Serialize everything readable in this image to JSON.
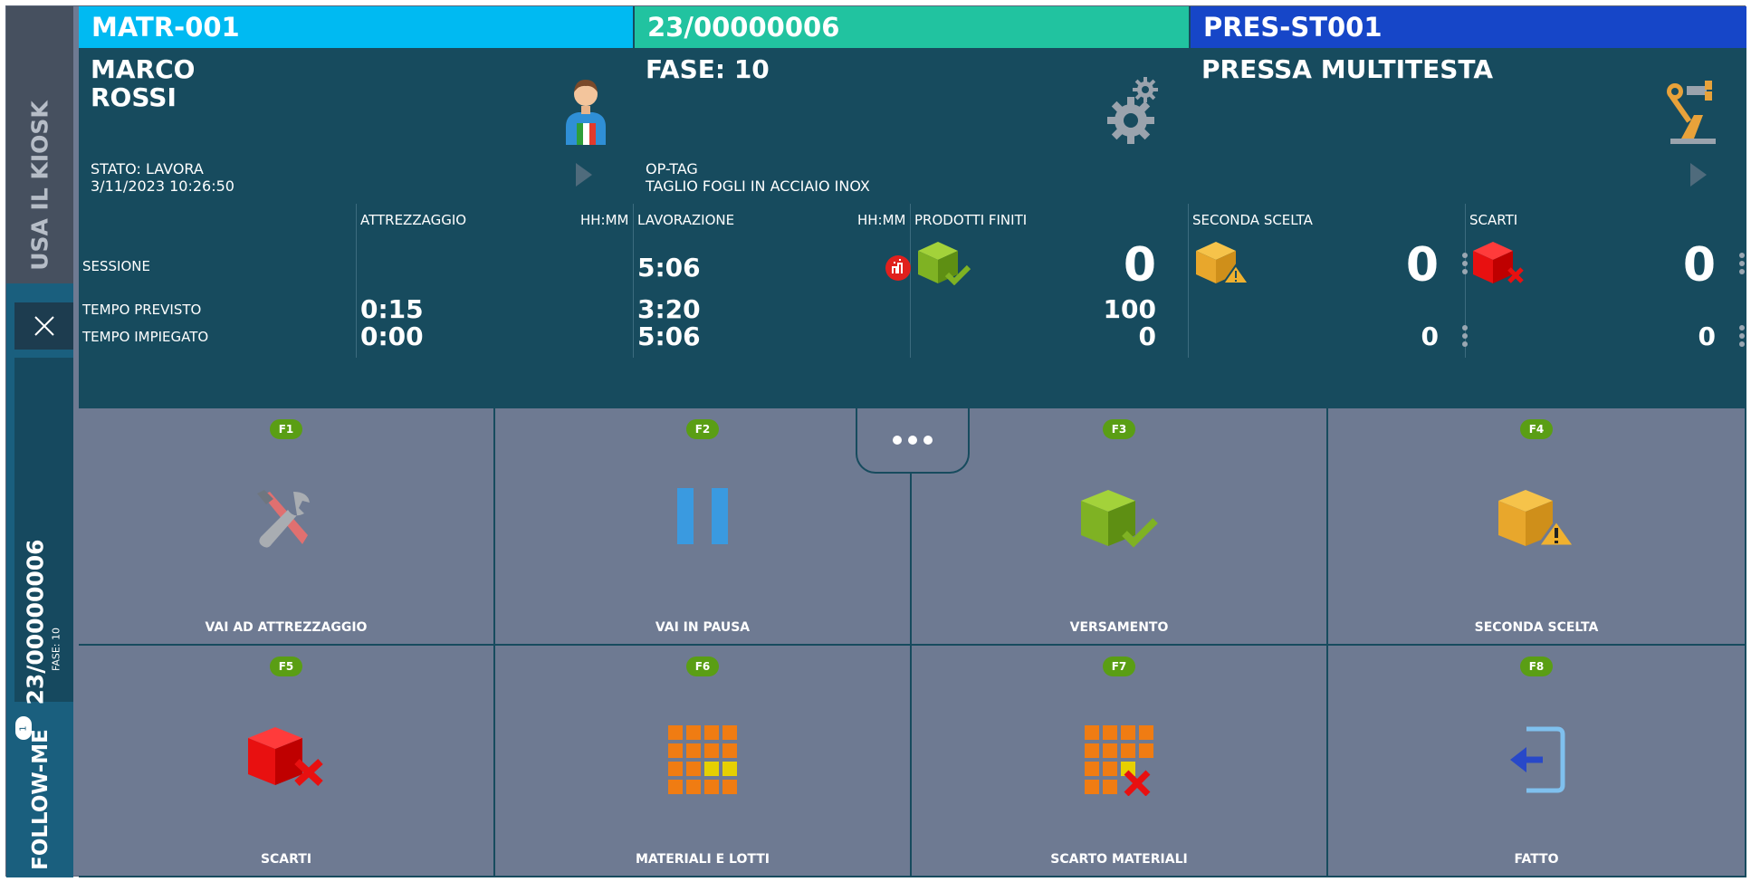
{
  "sidebar": {
    "kiosk_label": "USA IL KIOSK",
    "order_number": "23/00000006",
    "order_phase": "FASE: 10",
    "follow_badge": "1",
    "follow_label": "FOLLOW-ME"
  },
  "operator": {
    "code": "MATR-001",
    "first_name": "MARCO",
    "last_name": "ROSSI",
    "status": "STATO: LAVORA",
    "datetime": "3/11/2023 10:26:50"
  },
  "order": {
    "code": "23/00000006",
    "phase": "FASE: 10",
    "operation_tag": "OP-TAG",
    "operation_desc": "TAGLIO FOGLI IN ACCIAIO INOX"
  },
  "resource": {
    "code": "PRES-ST001",
    "name": "PRESSA MULTITESTA"
  },
  "stats": {
    "row_labels": {
      "session": "SESSIONE",
      "expected": "TEMPO PREVISTO",
      "elapsed": "TEMPO IMPIEGATO"
    },
    "setup": {
      "header": "ATTREZZAGGIO",
      "unit": "HH:MM",
      "expected": "0:15",
      "elapsed": "0:00"
    },
    "work": {
      "header": "LAVORAZIONE",
      "unit": "HH:MM",
      "session": "5:06",
      "expected": "3:20",
      "elapsed": "5:06"
    },
    "finished": {
      "header": "PRODOTTI FINITI",
      "session": "0",
      "expected": "100",
      "elapsed": "0"
    },
    "second_choice": {
      "header": "SECONDA SCELTA",
      "session": "0",
      "elapsed": "0"
    },
    "scrap": {
      "header": "SCARTI",
      "session": "0",
      "elapsed": "0"
    }
  },
  "actions": [
    {
      "key": "F1",
      "label": "VAI AD ATTREZZAGGIO",
      "icon": "tools-icon"
    },
    {
      "key": "F2",
      "label": "VAI IN PAUSA",
      "icon": "pause-icon"
    },
    {
      "key": "F3",
      "label": "VERSAMENTO",
      "icon": "box-check-icon"
    },
    {
      "key": "F4",
      "label": "SECONDA SCELTA",
      "icon": "box-warning-icon"
    },
    {
      "key": "F5",
      "label": "SCARTI",
      "icon": "box-scrap-icon"
    },
    {
      "key": "F6",
      "label": "MATERIALI E LOTTI",
      "icon": "materials-grid-icon"
    },
    {
      "key": "F7",
      "label": "SCARTO MATERIALI",
      "icon": "materials-scrap-icon"
    },
    {
      "key": "F8",
      "label": "FATTO",
      "icon": "exit-icon"
    }
  ],
  "colors": {
    "operator_bar": "#00baf2",
    "order_bar": "#21c3a0",
    "resource_bar": "#1646c8",
    "panel_bg": "#174b5e",
    "tile_bg": "#6e7a92",
    "fkey_badge": "#5a9e14"
  }
}
